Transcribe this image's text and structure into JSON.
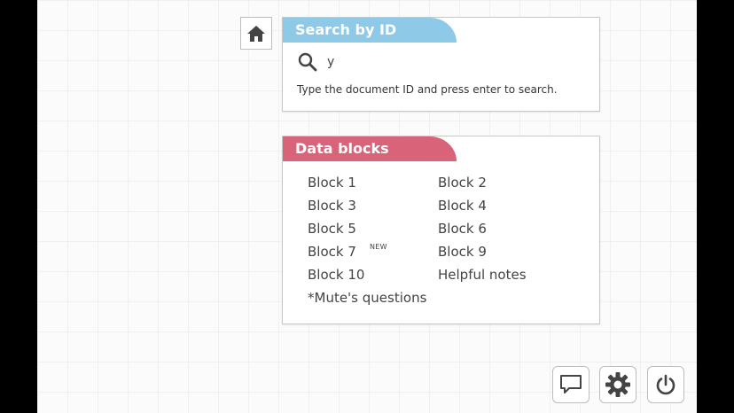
{
  "search": {
    "title": "Search by ID",
    "value": "y",
    "hint": "Type the document ID and press enter to search."
  },
  "blocks": {
    "title": "Data blocks",
    "badge": "NEW",
    "items": [
      "Block 1",
      "Block 2",
      "Block 3",
      "Block 4",
      "Block 5",
      "Block 6",
      "Block 7",
      "Block 9",
      "Block 10",
      "Helpful notes",
      "*Mute's questions"
    ]
  },
  "icons": [
    "home-icon",
    "search-icon",
    "feedback-icon",
    "gear-icon",
    "power-icon"
  ],
  "colors": {
    "search_header": "#8ec9e8",
    "blocks_header": "#d96379",
    "text": "#444444"
  }
}
